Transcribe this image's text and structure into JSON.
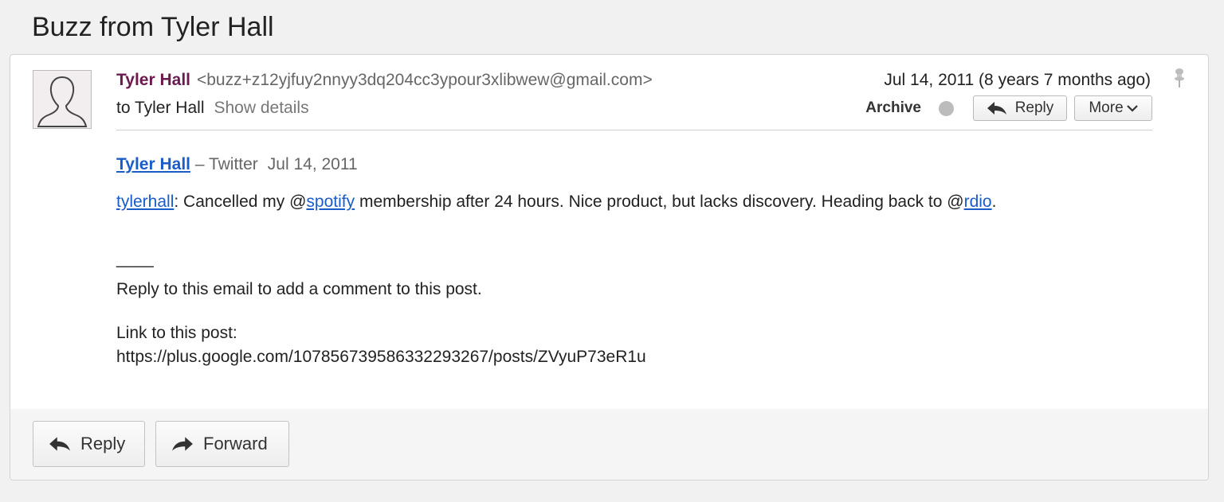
{
  "subject": "Buzz from Tyler Hall",
  "message": {
    "sender_name": "Tyler Hall",
    "sender_email": "<buzz+z12yjfuy2nnyy3dq204cc3ypour3xlibwew@gmail.com>",
    "recipient": "to Tyler Hall",
    "show_details_label": "Show details",
    "date": "Jul 14, 2011 (8 years 7 months ago)",
    "archive_label": "Archive",
    "reply_label": "Reply",
    "more_label": "More"
  },
  "post": {
    "author": "Tyler Hall",
    "source": " – Twitter",
    "date": "Jul 14, 2011",
    "tweet_user": "tylerhall",
    "tweet_part1": ": Cancelled my @",
    "tweet_mention1": "spotify",
    "tweet_part2": " membership after 24 hours. Nice product, but lacks discovery. Heading back to @",
    "tweet_mention2": "rdio",
    "tweet_end": "."
  },
  "signature": {
    "separator": "____",
    "reply_note": "Reply to this email to add a comment to this post.",
    "link_label": "Link to this post:",
    "link_url": "https://plus.google.com/107856739586332293267/posts/ZVyuP73eR1u"
  },
  "footer": {
    "reply_label": "Reply",
    "forward_label": "Forward"
  },
  "colors": {
    "sender": "#6b1a4f",
    "link": "#1a5cc8",
    "background": "#f1f1f1"
  }
}
